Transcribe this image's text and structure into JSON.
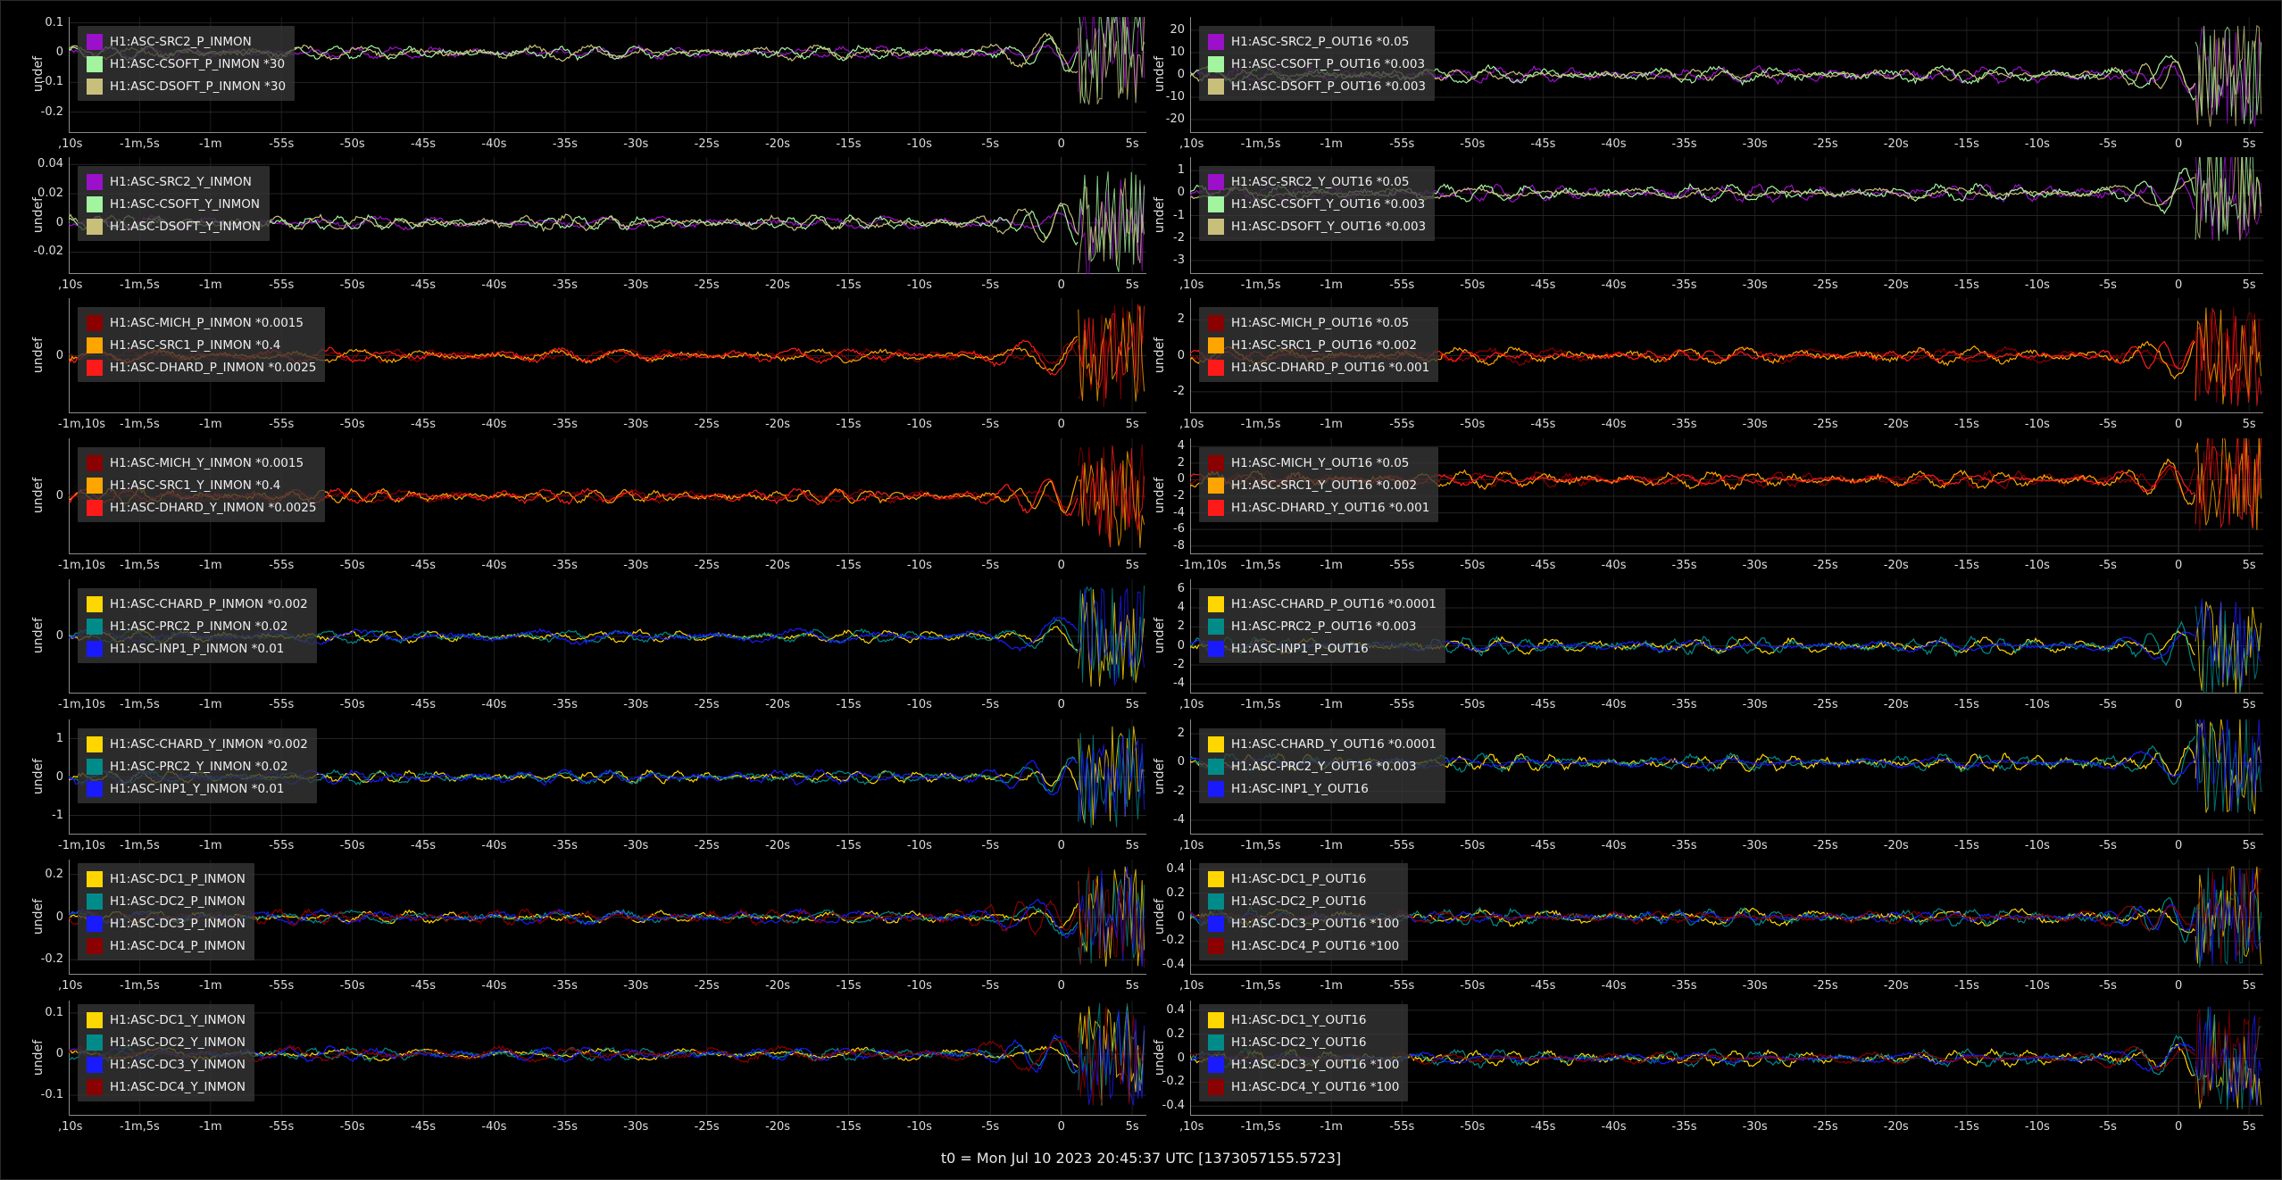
{
  "footer": "t0 = Mon Jul 10 2023 20:45:37 UTC [1373057155.5723]",
  "ylabel": "undef",
  "panels": [
    {
      "y_ticks": [
        "0.1",
        "0",
        "-0.1",
        "-0.2"
      ],
      "y_tick_vals": [
        0.1,
        0,
        -0.1,
        -0.2
      ],
      "ylim": [
        -0.27,
        0.12
      ],
      "x_ticks": [
        ",10s",
        "-1m,5s",
        "-1m",
        "-55s",
        "-50s",
        "-45s",
        "-40s",
        "-35s",
        "-30s",
        "-25s",
        "-20s",
        "-15s",
        "-10s",
        "-5s",
        "0",
        "5s"
      ],
      "legend": [
        {
          "label": "H1:ASC-SRC2_P_INMON",
          "color": "#9b10c9"
        },
        {
          "label": "H1:ASC-CSOFT_P_INMON *30",
          "color": "#a2f59e"
        },
        {
          "label": "H1:ASC-DSOFT_P_INMON *30",
          "color": "#c8bf7a"
        }
      ]
    },
    {
      "y_ticks": [
        "20",
        "10",
        "0",
        "-10",
        "-20"
      ],
      "y_tick_vals": [
        20,
        10,
        0,
        -10,
        -20
      ],
      "ylim": [
        -26,
        26
      ],
      "x_ticks": [
        ",10s",
        "-1m,5s",
        "-1m",
        "-55s",
        "-50s",
        "-45s",
        "-40s",
        "-35s",
        "-30s",
        "-25s",
        "-20s",
        "-15s",
        "-10s",
        "-5s",
        "0",
        "5s"
      ],
      "legend": [
        {
          "label": "H1:ASC-SRC2_P_OUT16 *0.05",
          "color": "#9b10c9"
        },
        {
          "label": "H1:ASC-CSOFT_P_OUT16 *0.003",
          "color": "#a2f59e"
        },
        {
          "label": "H1:ASC-DSOFT_P_OUT16 *0.003",
          "color": "#c8bf7a"
        }
      ]
    },
    {
      "y_ticks": [
        "0.04",
        "0.02",
        "0",
        "-0.02"
      ],
      "y_tick_vals": [
        0.04,
        0.02,
        0,
        -0.02
      ],
      "ylim": [
        -0.035,
        0.045
      ],
      "x_ticks": [
        ",10s",
        "-1m,5s",
        "-1m",
        "-55s",
        "-50s",
        "-45s",
        "-40s",
        "-35s",
        "-30s",
        "-25s",
        "-20s",
        "-15s",
        "-10s",
        "-5s",
        "0",
        "5s"
      ],
      "legend": [
        {
          "label": "H1:ASC-SRC2_Y_INMON",
          "color": "#9b10c9"
        },
        {
          "label": "H1:ASC-CSOFT_Y_INMON",
          "color": "#a2f59e"
        },
        {
          "label": "H1:ASC-DSOFT_Y_INMON",
          "color": "#c8bf7a"
        }
      ]
    },
    {
      "y_ticks": [
        "1",
        "0",
        "-1",
        "-2",
        "-3"
      ],
      "y_tick_vals": [
        1,
        0,
        -1,
        -2,
        -3
      ],
      "ylim": [
        -3.6,
        1.6
      ],
      "x_ticks": [
        ",10s",
        "-1m,5s",
        "-1m",
        "-55s",
        "-50s",
        "-45s",
        "-40s",
        "-35s",
        "-30s",
        "-25s",
        "-20s",
        "-15s",
        "-10s",
        "-5s",
        "0",
        "5s"
      ],
      "legend": [
        {
          "label": "H1:ASC-SRC2_Y_OUT16 *0.05",
          "color": "#9b10c9"
        },
        {
          "label": "H1:ASC-CSOFT_Y_OUT16 *0.003",
          "color": "#a2f59e"
        },
        {
          "label": "H1:ASC-DSOFT_Y_OUT16 *0.003",
          "color": "#c8bf7a"
        }
      ]
    },
    {
      "y_ticks": [
        "0"
      ],
      "y_tick_vals": [
        0
      ],
      "ylim": [
        -1,
        1
      ],
      "x_ticks": [
        "-1m,10s",
        "-1m,5s",
        "-1m",
        "-55s",
        "-50s",
        "-45s",
        "-40s",
        "-35s",
        "-30s",
        "-25s",
        "-20s",
        "-15s",
        "-10s",
        "-5s",
        "0",
        "5s"
      ],
      "legend": [
        {
          "label": "H1:ASC-MICH_P_INMON *0.0015",
          "color": "#8b0000"
        },
        {
          "label": "H1:ASC-SRC1_P_INMON *0.4",
          "color": "#ffa500"
        },
        {
          "label": "H1:ASC-DHARD_P_INMON *0.0025",
          "color": "#ff1a1a"
        }
      ]
    },
    {
      "y_ticks": [
        "2",
        "0",
        "-2"
      ],
      "y_tick_vals": [
        2,
        0,
        -2
      ],
      "ylim": [
        -3.2,
        3.2
      ],
      "x_ticks": [
        ",10s",
        "-1m,5s",
        "-1m",
        "-55s",
        "-50s",
        "-45s",
        "-40s",
        "-35s",
        "-30s",
        "-25s",
        "-20s",
        "-15s",
        "-10s",
        "-5s",
        "0",
        "5s"
      ],
      "legend": [
        {
          "label": "H1:ASC-MICH_P_OUT16 *0.05",
          "color": "#8b0000"
        },
        {
          "label": "H1:ASC-SRC1_P_OUT16 *0.002",
          "color": "#ffa500"
        },
        {
          "label": "H1:ASC-DHARD_P_OUT16 *0.001",
          "color": "#ff1a1a"
        }
      ]
    },
    {
      "y_ticks": [
        "0"
      ],
      "y_tick_vals": [
        0
      ],
      "ylim": [
        -1,
        1
      ],
      "x_ticks": [
        "-1m,10s",
        "-1m,5s",
        "-1m",
        "-55s",
        "-50s",
        "-45s",
        "-40s",
        "-35s",
        "-30s",
        "-25s",
        "-20s",
        "-15s",
        "-10s",
        "-5s",
        "0",
        "5s"
      ],
      "legend": [
        {
          "label": "H1:ASC-MICH_Y_INMON *0.0015",
          "color": "#8b0000"
        },
        {
          "label": "H1:ASC-SRC1_Y_INMON *0.4",
          "color": "#ffa500"
        },
        {
          "label": "H1:ASC-DHARD_Y_INMON *0.0025",
          "color": "#ff1a1a"
        }
      ]
    },
    {
      "y_ticks": [
        "4",
        "2",
        "0",
        "-2",
        "-4",
        "-6",
        "-8"
      ],
      "y_tick_vals": [
        4,
        2,
        0,
        -2,
        -4,
        -6,
        -8
      ],
      "ylim": [
        -9,
        5
      ],
      "x_ticks": [
        "-1m,10s",
        "-1m,5s",
        "-1m",
        "-55s",
        "-50s",
        "-45s",
        "-40s",
        "-35s",
        "-30s",
        "-25s",
        "-20s",
        "-15s",
        "-10s",
        "-5s",
        "0",
        "5s"
      ],
      "legend": [
        {
          "label": "H1:ASC-MICH_Y_OUT16 *0.05",
          "color": "#8b0000"
        },
        {
          "label": "H1:ASC-SRC1_Y_OUT16 *0.002",
          "color": "#ffa500"
        },
        {
          "label": "H1:ASC-DHARD_Y_OUT16 *0.001",
          "color": "#ff1a1a"
        }
      ]
    },
    {
      "y_ticks": [
        "0"
      ],
      "y_tick_vals": [
        0
      ],
      "ylim": [
        -1,
        1
      ],
      "x_ticks": [
        "-1m,10s",
        "-1m,5s",
        "-1m",
        "-55s",
        "-50s",
        "-45s",
        "-40s",
        "-35s",
        "-30s",
        "-25s",
        "-20s",
        "-15s",
        "-10s",
        "-5s",
        "0",
        "5s"
      ],
      "legend": [
        {
          "label": "H1:ASC-CHARD_P_INMON *0.002",
          "color": "#ffd700"
        },
        {
          "label": "H1:ASC-PRC2_P_INMON *0.02",
          "color": "#008b8b"
        },
        {
          "label": "H1:ASC-INP1_P_INMON *0.01",
          "color": "#1a1aff"
        }
      ]
    },
    {
      "y_ticks": [
        "6",
        "4",
        "2",
        "0",
        "-2",
        "-4"
      ],
      "y_tick_vals": [
        6,
        4,
        2,
        0,
        -2,
        -4
      ],
      "ylim": [
        -5,
        7
      ],
      "x_ticks": [
        ",10s",
        "-1m,5s",
        "-1m",
        "-55s",
        "-50s",
        "-45s",
        "-40s",
        "-35s",
        "-30s",
        "-25s",
        "-20s",
        "-15s",
        "-10s",
        "-5s",
        "0",
        "5s"
      ],
      "legend": [
        {
          "label": "H1:ASC-CHARD_P_OUT16 *0.0001",
          "color": "#ffd700"
        },
        {
          "label": "H1:ASC-PRC2_P_OUT16 *0.003",
          "color": "#008b8b"
        },
        {
          "label": "H1:ASC-INP1_P_OUT16",
          "color": "#1a1aff"
        }
      ]
    },
    {
      "y_ticks": [
        "1",
        "0",
        "-1"
      ],
      "y_tick_vals": [
        1,
        0,
        -1
      ],
      "ylim": [
        -1.5,
        1.5
      ],
      "x_ticks": [
        "-1m,10s",
        "-1m,5s",
        "-1m",
        "-55s",
        "-50s",
        "-45s",
        "-40s",
        "-35s",
        "-30s",
        "-25s",
        "-20s",
        "-15s",
        "-10s",
        "-5s",
        "0",
        "5s"
      ],
      "legend": [
        {
          "label": "H1:ASC-CHARD_Y_INMON *0.002",
          "color": "#ffd700"
        },
        {
          "label": "H1:ASC-PRC2_Y_INMON *0.02",
          "color": "#008b8b"
        },
        {
          "label": "H1:ASC-INP1_Y_INMON *0.01",
          "color": "#1a1aff"
        }
      ]
    },
    {
      "y_ticks": [
        "2",
        "0",
        "-2",
        "-4"
      ],
      "y_tick_vals": [
        2,
        0,
        -2,
        -4
      ],
      "ylim": [
        -5,
        3
      ],
      "x_ticks": [
        ",10s",
        "-1m,5s",
        "-1m",
        "-55s",
        "-50s",
        "-45s",
        "-40s",
        "-35s",
        "-30s",
        "-25s",
        "-20s",
        "-15s",
        "-10s",
        "-5s",
        "0",
        "5s"
      ],
      "legend": [
        {
          "label": "H1:ASC-CHARD_Y_OUT16 *0.0001",
          "color": "#ffd700"
        },
        {
          "label": "H1:ASC-PRC2_Y_OUT16 *0.003",
          "color": "#008b8b"
        },
        {
          "label": "H1:ASC-INP1_Y_OUT16",
          "color": "#1a1aff"
        }
      ]
    },
    {
      "y_ticks": [
        "0.2",
        "0",
        "-0.2"
      ],
      "y_tick_vals": [
        0.2,
        0,
        -0.2
      ],
      "ylim": [
        -0.27,
        0.27
      ],
      "x_ticks": [
        ",10s",
        "-1m,5s",
        "-1m",
        "-55s",
        "-50s",
        "-45s",
        "-40s",
        "-35s",
        "-30s",
        "-25s",
        "-20s",
        "-15s",
        "-10s",
        "-5s",
        "0",
        "5s"
      ],
      "legend": [
        {
          "label": "H1:ASC-DC1_P_INMON",
          "color": "#ffd700"
        },
        {
          "label": "H1:ASC-DC2_P_INMON",
          "color": "#008b8b"
        },
        {
          "label": "H1:ASC-DC3_P_INMON",
          "color": "#1a1aff"
        },
        {
          "label": "H1:ASC-DC4_P_INMON",
          "color": "#8b0000"
        }
      ]
    },
    {
      "y_ticks": [
        "0.4",
        "0.2",
        "0",
        "-0.2",
        "-0.4"
      ],
      "y_tick_vals": [
        0.4,
        0.2,
        0,
        -0.2,
        -0.4
      ],
      "ylim": [
        -0.48,
        0.48
      ],
      "x_ticks": [
        ",10s",
        "-1m,5s",
        "-1m",
        "-55s",
        "-50s",
        "-45s",
        "-40s",
        "-35s",
        "-30s",
        "-25s",
        "-20s",
        "-15s",
        "-10s",
        "-5s",
        "0",
        "5s"
      ],
      "legend": [
        {
          "label": "H1:ASC-DC1_P_OUT16",
          "color": "#ffd700"
        },
        {
          "label": "H1:ASC-DC2_P_OUT16",
          "color": "#008b8b"
        },
        {
          "label": "H1:ASC-DC3_P_OUT16 *100",
          "color": "#1a1aff"
        },
        {
          "label": "H1:ASC-DC4_P_OUT16 *100",
          "color": "#8b0000"
        }
      ]
    },
    {
      "y_ticks": [
        "0.1",
        "0",
        "-0.1"
      ],
      "y_tick_vals": [
        0.1,
        0,
        -0.1
      ],
      "ylim": [
        -0.15,
        0.13
      ],
      "x_ticks": [
        ",10s",
        "-1m,5s",
        "-1m",
        "-55s",
        "-50s",
        "-45s",
        "-40s",
        "-35s",
        "-30s",
        "-25s",
        "-20s",
        "-15s",
        "-10s",
        "-5s",
        "0",
        "5s"
      ],
      "legend": [
        {
          "label": "H1:ASC-DC1_Y_INMON",
          "color": "#ffd700"
        },
        {
          "label": "H1:ASC-DC2_Y_INMON",
          "color": "#008b8b"
        },
        {
          "label": "H1:ASC-DC3_Y_INMON",
          "color": "#1a1aff"
        },
        {
          "label": "H1:ASC-DC4_Y_INMON",
          "color": "#8b0000"
        }
      ]
    },
    {
      "y_ticks": [
        "0.4",
        "0.2",
        "0",
        "-0.2",
        "-0.4"
      ],
      "y_tick_vals": [
        0.4,
        0.2,
        0,
        -0.2,
        -0.4
      ],
      "ylim": [
        -0.48,
        0.48
      ],
      "x_ticks": [
        ",10s",
        "-1m,5s",
        "-1m",
        "-55s",
        "-50s",
        "-45s",
        "-40s",
        "-35s",
        "-30s",
        "-25s",
        "-20s",
        "-15s",
        "-10s",
        "-5s",
        "0",
        "5s"
      ],
      "legend": [
        {
          "label": "H1:ASC-DC1_Y_OUT16",
          "color": "#ffd700"
        },
        {
          "label": "H1:ASC-DC2_Y_OUT16",
          "color": "#008b8b"
        },
        {
          "label": "H1:ASC-DC3_Y_OUT16 *100",
          "color": "#1a1aff"
        },
        {
          "label": "H1:ASC-DC4_Y_OUT16 *100",
          "color": "#8b0000"
        }
      ]
    }
  ]
}
